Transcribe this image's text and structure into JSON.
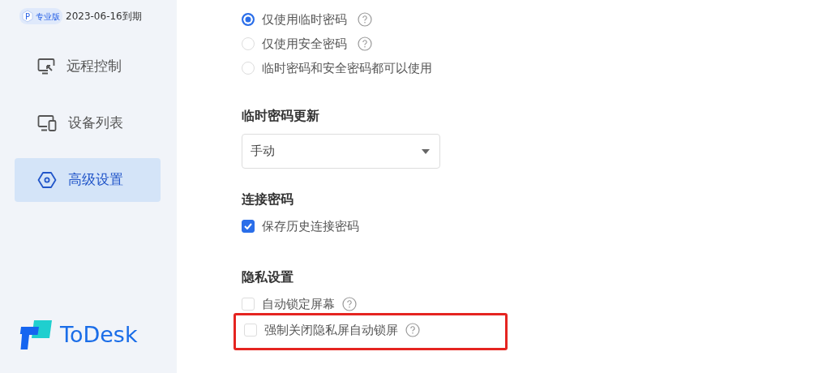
{
  "sidebar": {
    "edition": {
      "mark": "P",
      "badge": "专业版",
      "expiry": "2023-06-16到期"
    },
    "items": [
      {
        "label": "远程控制",
        "selected": false
      },
      {
        "label": "设备列表",
        "selected": false
      },
      {
        "label": "高级设置",
        "selected": true
      }
    ],
    "logo": "ToDesk"
  },
  "password_mode": [
    {
      "label": "仅使用临时密码",
      "selected": true,
      "help": true
    },
    {
      "label": "仅使用安全密码",
      "selected": false,
      "help": true
    },
    {
      "label": "临时密码和安全密码都可以使用",
      "selected": false,
      "help": false
    }
  ],
  "temp_password_update": {
    "heading": "临时密码更新",
    "value": "手动"
  },
  "connection_password": {
    "heading": "连接密码",
    "options": [
      {
        "label": "保存历史连接密码",
        "checked": true,
        "help": false,
        "highlighted": false
      }
    ]
  },
  "privacy": {
    "heading": "隐私设置",
    "options": [
      {
        "label": "自动锁定屏幕",
        "checked": false,
        "help": true,
        "highlighted": false
      },
      {
        "label": "强制关闭隐私屏自动锁屏",
        "checked": false,
        "help": true,
        "highlighted": true
      }
    ]
  }
}
